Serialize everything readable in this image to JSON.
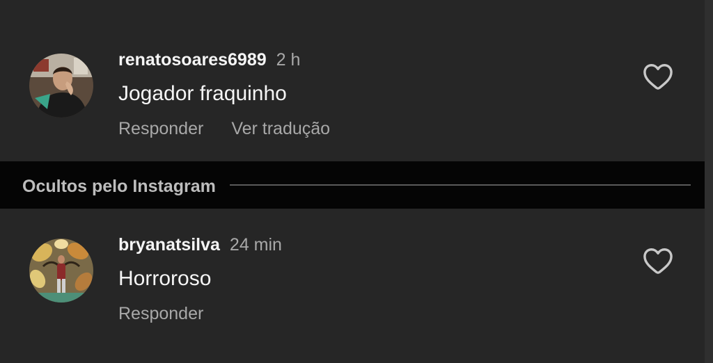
{
  "comments": [
    {
      "username": "renatosoares6989",
      "time": "2 h",
      "text": "Jogador fraquinho",
      "reply_label": "Responder",
      "translate_label": "Ver tradução",
      "like_icon": "heart-outline-icon"
    },
    {
      "username": "bryanatsilva",
      "time": "24 min",
      "text": "Horroroso",
      "reply_label": "Responder",
      "like_icon": "heart-outline-icon"
    }
  ],
  "hidden_section": {
    "label": "Ocultos pelo Instagram"
  },
  "colors": {
    "background": "#262626",
    "hidden_bar": "#050505",
    "primary_text": "#f5f5f5",
    "secondary_text": "#a8a8a8"
  }
}
